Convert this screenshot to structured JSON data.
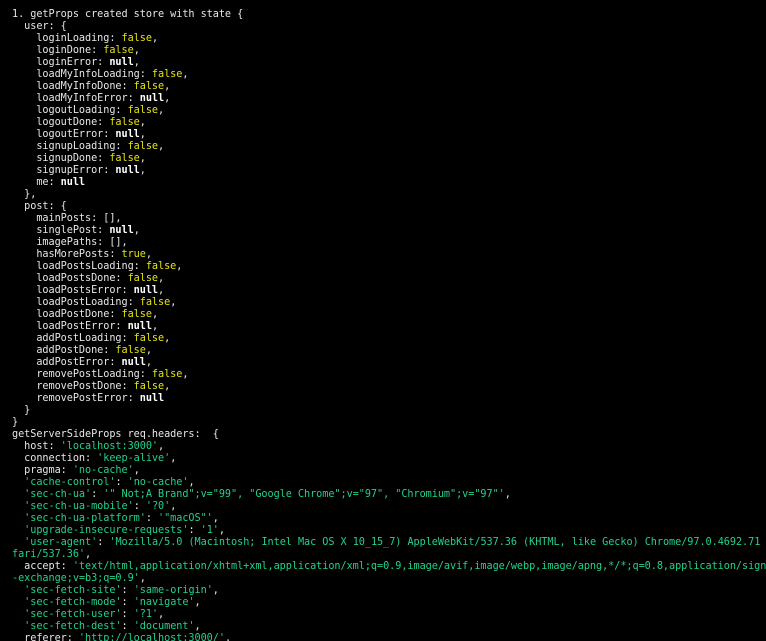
{
  "colors": {
    "background": "#000000",
    "default_text": "#e6e6e6",
    "boolean": "#e5e510",
    "null": "#ffffff",
    "string": "#23d18b"
  },
  "lines": [
    [
      [
        "w",
        "1. getProps created store with state {"
      ]
    ],
    [
      [
        "w",
        "  user: {"
      ]
    ],
    [
      [
        "w",
        "    loginLoading: "
      ],
      [
        "y",
        "false"
      ],
      [
        "w",
        ","
      ]
    ],
    [
      [
        "w",
        "    loginDone: "
      ],
      [
        "y",
        "false"
      ],
      [
        "w",
        ","
      ]
    ],
    [
      [
        "w",
        "    loginError: "
      ],
      [
        "b",
        "null"
      ],
      [
        "w",
        ","
      ]
    ],
    [
      [
        "w",
        "    loadMyInfoLoading: "
      ],
      [
        "y",
        "false"
      ],
      [
        "w",
        ","
      ]
    ],
    [
      [
        "w",
        "    loadMyInfoDone: "
      ],
      [
        "y",
        "false"
      ],
      [
        "w",
        ","
      ]
    ],
    [
      [
        "w",
        "    loadMyInfoError: "
      ],
      [
        "b",
        "null"
      ],
      [
        "w",
        ","
      ]
    ],
    [
      [
        "w",
        "    logoutLoading: "
      ],
      [
        "y",
        "false"
      ],
      [
        "w",
        ","
      ]
    ],
    [
      [
        "w",
        "    logoutDone: "
      ],
      [
        "y",
        "false"
      ],
      [
        "w",
        ","
      ]
    ],
    [
      [
        "w",
        "    logoutError: "
      ],
      [
        "b",
        "null"
      ],
      [
        "w",
        ","
      ]
    ],
    [
      [
        "w",
        "    signupLoading: "
      ],
      [
        "y",
        "false"
      ],
      [
        "w",
        ","
      ]
    ],
    [
      [
        "w",
        "    signupDone: "
      ],
      [
        "y",
        "false"
      ],
      [
        "w",
        ","
      ]
    ],
    [
      [
        "w",
        "    signupError: "
      ],
      [
        "b",
        "null"
      ],
      [
        "w",
        ","
      ]
    ],
    [
      [
        "w",
        "    me: "
      ],
      [
        "b",
        "null"
      ]
    ],
    [
      [
        "w",
        "  },"
      ]
    ],
    [
      [
        "w",
        "  post: {"
      ]
    ],
    [
      [
        "w",
        "    mainPosts: [],"
      ]
    ],
    [
      [
        "w",
        "    singlePost: "
      ],
      [
        "b",
        "null"
      ],
      [
        "w",
        ","
      ]
    ],
    [
      [
        "w",
        "    imagePaths: [],"
      ]
    ],
    [
      [
        "w",
        "    hasMorePosts: "
      ],
      [
        "y",
        "true"
      ],
      [
        "w",
        ","
      ]
    ],
    [
      [
        "w",
        "    loadPostsLoading: "
      ],
      [
        "y",
        "false"
      ],
      [
        "w",
        ","
      ]
    ],
    [
      [
        "w",
        "    loadPostsDone: "
      ],
      [
        "y",
        "false"
      ],
      [
        "w",
        ","
      ]
    ],
    [
      [
        "w",
        "    loadPostsError: "
      ],
      [
        "b",
        "null"
      ],
      [
        "w",
        ","
      ]
    ],
    [
      [
        "w",
        "    loadPostLoading: "
      ],
      [
        "y",
        "false"
      ],
      [
        "w",
        ","
      ]
    ],
    [
      [
        "w",
        "    loadPostDone: "
      ],
      [
        "y",
        "false"
      ],
      [
        "w",
        ","
      ]
    ],
    [
      [
        "w",
        "    loadPostError: "
      ],
      [
        "b",
        "null"
      ],
      [
        "w",
        ","
      ]
    ],
    [
      [
        "w",
        "    addPostLoading: "
      ],
      [
        "y",
        "false"
      ],
      [
        "w",
        ","
      ]
    ],
    [
      [
        "w",
        "    addPostDone: "
      ],
      [
        "y",
        "false"
      ],
      [
        "w",
        ","
      ]
    ],
    [
      [
        "w",
        "    addPostError: "
      ],
      [
        "b",
        "null"
      ],
      [
        "w",
        ","
      ]
    ],
    [
      [
        "w",
        "    removePostLoading: "
      ],
      [
        "y",
        "false"
      ],
      [
        "w",
        ","
      ]
    ],
    [
      [
        "w",
        "    removePostDone: "
      ],
      [
        "y",
        "false"
      ],
      [
        "w",
        ","
      ]
    ],
    [
      [
        "w",
        "    removePostError: "
      ],
      [
        "b",
        "null"
      ]
    ],
    [
      [
        "w",
        "  }"
      ]
    ],
    [
      [
        "w",
        "}"
      ]
    ],
    [
      [
        "w",
        "getServerSideProps req.headers:  {"
      ]
    ],
    [
      [
        "w",
        "  host: "
      ],
      [
        "g",
        "'localhost:3000'"
      ],
      [
        "w",
        ","
      ]
    ],
    [
      [
        "w",
        "  connection: "
      ],
      [
        "g",
        "'keep-alive'"
      ],
      [
        "w",
        ","
      ]
    ],
    [
      [
        "w",
        "  pragma: "
      ],
      [
        "g",
        "'no-cache'"
      ],
      [
        "w",
        ","
      ]
    ],
    [
      [
        "w",
        "  "
      ],
      [
        "g",
        "'cache-control'"
      ],
      [
        "w",
        ": "
      ],
      [
        "g",
        "'no-cache'"
      ],
      [
        "w",
        ","
      ]
    ],
    [
      [
        "w",
        "  "
      ],
      [
        "g",
        "'sec-ch-ua'"
      ],
      [
        "w",
        ": "
      ],
      [
        "g",
        "'\" Not;A Brand\";v=\"99\", \"Google Chrome\";v=\"97\", \"Chromium\";v=\"97\"'"
      ],
      [
        "w",
        ","
      ]
    ],
    [
      [
        "w",
        "  "
      ],
      [
        "g",
        "'sec-ch-ua-mobile'"
      ],
      [
        "w",
        ": "
      ],
      [
        "g",
        "'?0'"
      ],
      [
        "w",
        ","
      ]
    ],
    [
      [
        "w",
        "  "
      ],
      [
        "g",
        "'sec-ch-ua-platform'"
      ],
      [
        "w",
        ": "
      ],
      [
        "g",
        "'\"macOS\"'"
      ],
      [
        "w",
        ","
      ]
    ],
    [
      [
        "w",
        "  "
      ],
      [
        "g",
        "'upgrade-insecure-requests'"
      ],
      [
        "w",
        ": "
      ],
      [
        "g",
        "'1'"
      ],
      [
        "w",
        ","
      ]
    ],
    [
      [
        "w",
        "  "
      ],
      [
        "g",
        "'user-agent'"
      ],
      [
        "w",
        ": "
      ],
      [
        "g",
        "'Mozilla/5.0 (Macintosh; Intel Mac OS X 10_15_7) AppleWebKit/537.36 (KHTML, like Gecko) Chrome/97.0.4692.71 Sa"
      ]
    ],
    [
      [
        "g",
        "fari/537.36'"
      ],
      [
        "w",
        ","
      ]
    ],
    [
      [
        "w",
        "  accept: "
      ],
      [
        "g",
        "'text/html,application/xhtml+xml,application/xml;q=0.9,image/avif,image/webp,image/apng,*/*;q=0.8,application/signed"
      ]
    ],
    [
      [
        "g",
        "-exchange;v=b3;q=0.9'"
      ],
      [
        "w",
        ","
      ]
    ],
    [
      [
        "w",
        "  "
      ],
      [
        "g",
        "'sec-fetch-site'"
      ],
      [
        "w",
        ": "
      ],
      [
        "g",
        "'same-origin'"
      ],
      [
        "w",
        ","
      ]
    ],
    [
      [
        "w",
        "  "
      ],
      [
        "g",
        "'sec-fetch-mode'"
      ],
      [
        "w",
        ": "
      ],
      [
        "g",
        "'navigate'"
      ],
      [
        "w",
        ","
      ]
    ],
    [
      [
        "w",
        "  "
      ],
      [
        "g",
        "'sec-fetch-user'"
      ],
      [
        "w",
        ": "
      ],
      [
        "g",
        "'?1'"
      ],
      [
        "w",
        ","
      ]
    ],
    [
      [
        "w",
        "  "
      ],
      [
        "g",
        "'sec-fetch-dest'"
      ],
      [
        "w",
        ": "
      ],
      [
        "g",
        "'document'"
      ],
      [
        "w",
        ","
      ]
    ],
    [
      [
        "w",
        "  referer: "
      ],
      [
        "g",
        "'http://localhost:3000/'"
      ],
      [
        "w",
        ","
      ]
    ]
  ]
}
